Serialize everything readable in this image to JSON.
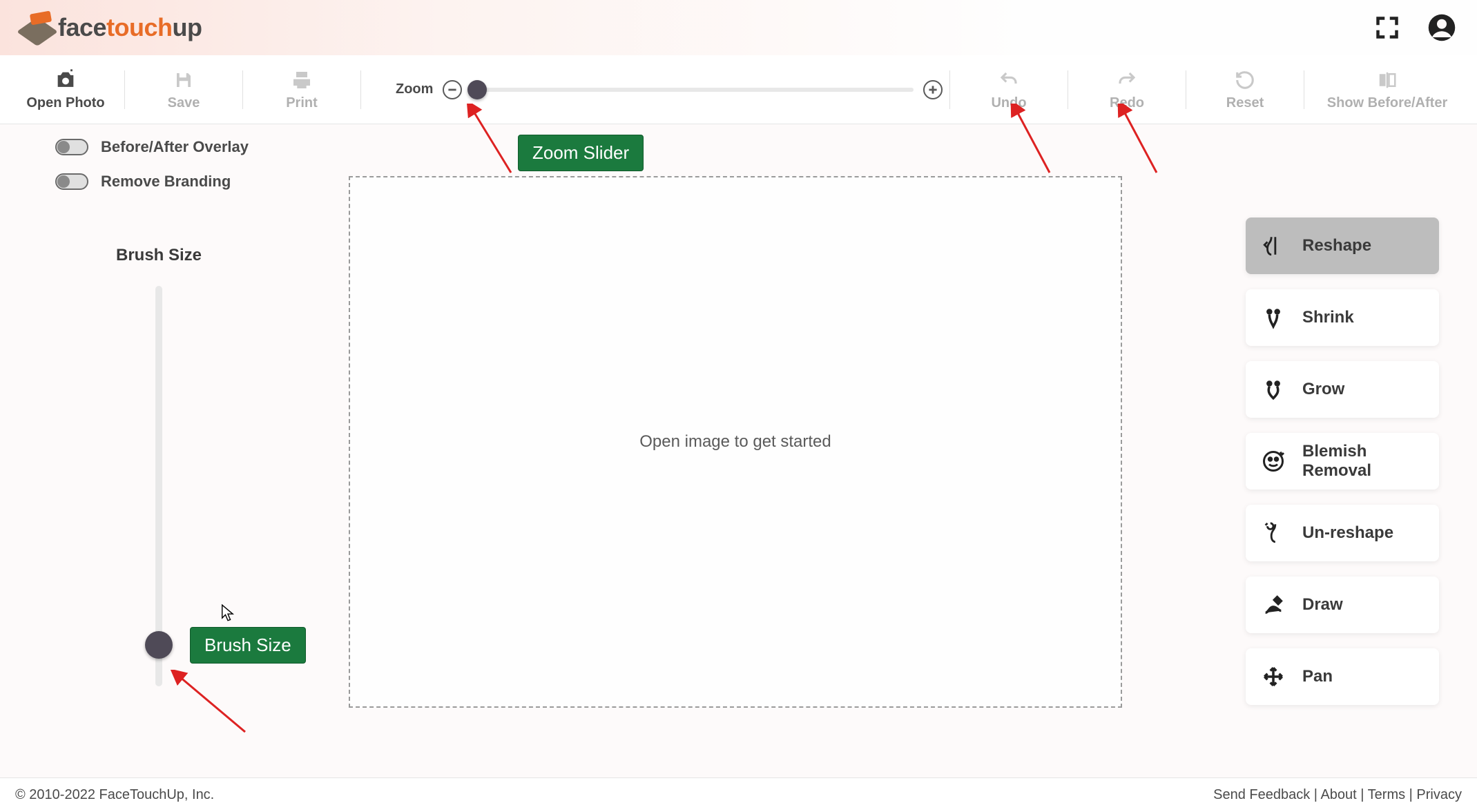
{
  "header": {
    "logo_face": "face",
    "logo_touch": "touch",
    "logo_up": "up"
  },
  "toolbar": {
    "open_photo": "Open Photo",
    "save": "Save",
    "print": "Print",
    "zoom_label": "Zoom",
    "undo": "Undo",
    "redo": "Redo",
    "reset": "Reset",
    "show_before_after": "Show Before/After"
  },
  "left": {
    "before_after_overlay": "Before/After Overlay",
    "remove_branding": "Remove Branding",
    "brush_size": "Brush Size"
  },
  "canvas": {
    "placeholder": "Open image to get started"
  },
  "tools": {
    "reshape": "Reshape",
    "shrink": "Shrink",
    "grow": "Grow",
    "blemish": "Blemish Removal",
    "unreshape": "Un-reshape",
    "draw": "Draw",
    "pan": "Pan"
  },
  "annotations": {
    "zoom_slider": "Zoom Slider",
    "brush_size": "Brush Size"
  },
  "footer": {
    "copyright": "© 2010-2022 FaceTouchUp, Inc.",
    "send_feedback": "Send Feedback",
    "about": "About",
    "terms": "Terms",
    "privacy": "Privacy",
    "sep": " | "
  }
}
